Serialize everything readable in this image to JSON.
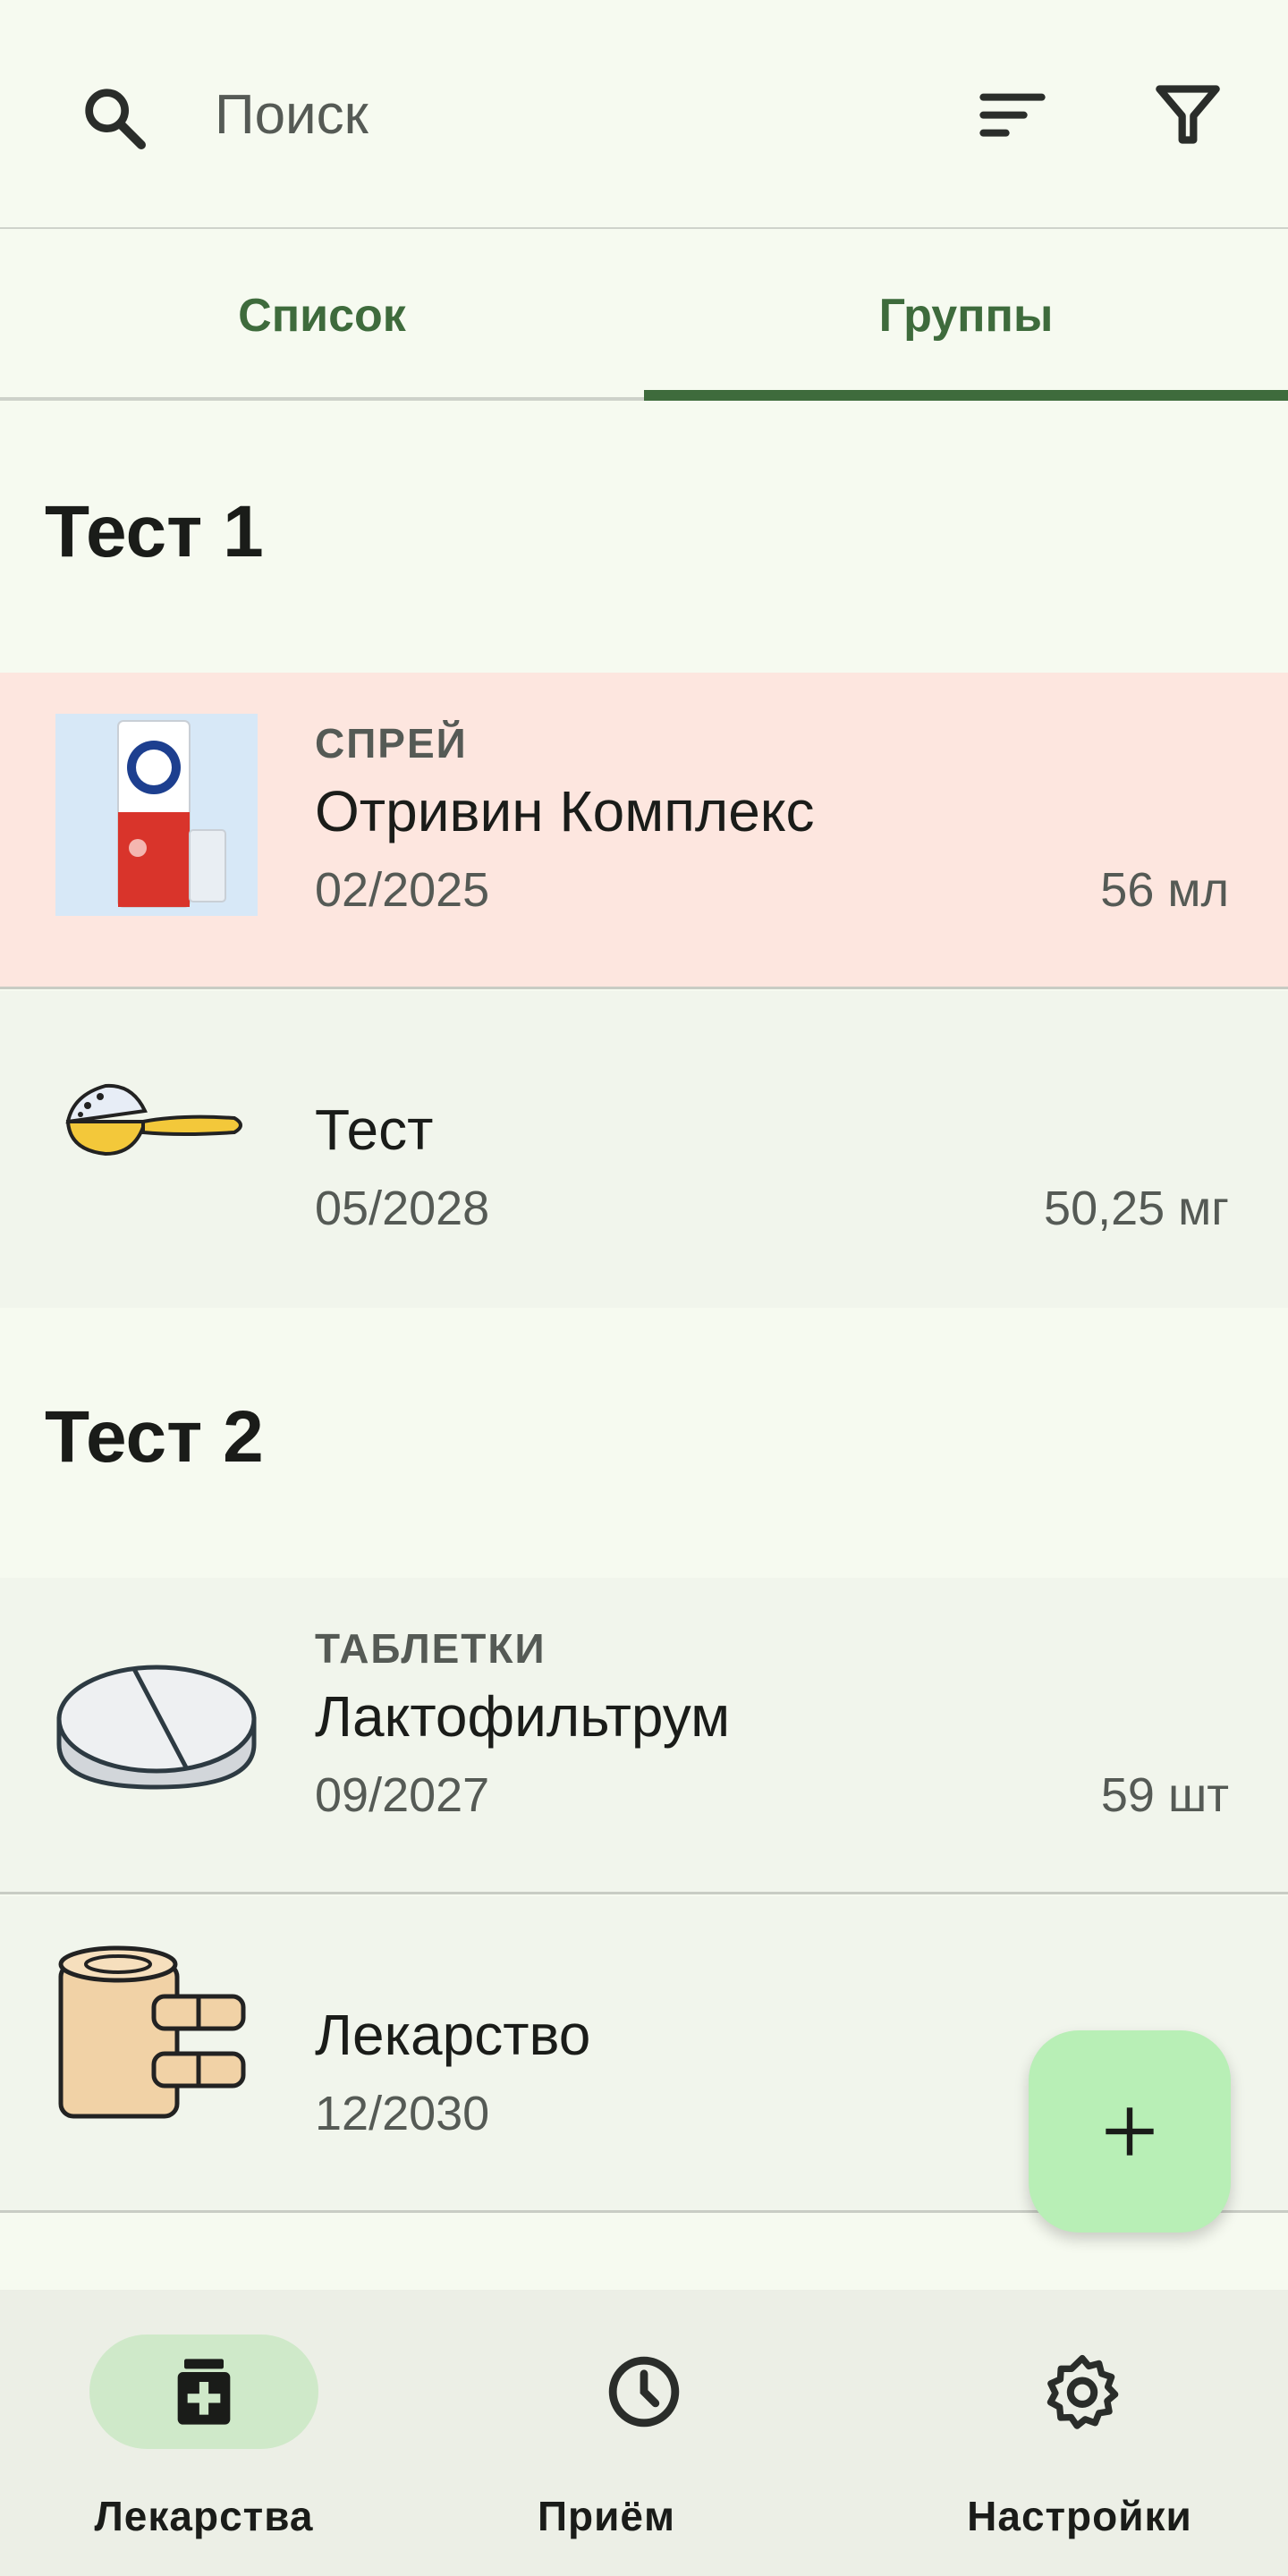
{
  "search": {
    "placeholder": "Поиск"
  },
  "tabs": [
    {
      "label": "Список",
      "selected": false
    },
    {
      "label": "Группы",
      "selected": true
    }
  ],
  "groups": [
    {
      "title": "Тест 1",
      "items": [
        {
          "type": "СПРЕЙ",
          "name": "Отривин Комплекс",
          "date": "02/2025",
          "amount": "56 мл",
          "thumb": "otrivin-spray-photo",
          "highlight": "#fde6df"
        },
        {
          "type": "",
          "name": "Тест",
          "date": "05/2028",
          "amount": "50,25 мг",
          "thumb": "powder-spoon-icon"
        }
      ]
    },
    {
      "title": "Тест 2",
      "items": [
        {
          "type": "ТАБЛЕТКИ",
          "name": "Лактофильтрум",
          "date": "09/2027",
          "amount": "59 шт",
          "thumb": "pill-tablet-icon"
        },
        {
          "type": "",
          "name": "Лекарство",
          "date": "12/2030",
          "amount": "",
          "thumb": "bandage-roll-icon"
        }
      ]
    }
  ],
  "fab": {
    "icon": "plus-icon"
  },
  "bottom_nav": [
    {
      "label": "Лекарства",
      "icon": "medicine-icon",
      "selected": true
    },
    {
      "label": "Приём",
      "icon": "clock-icon",
      "selected": false
    },
    {
      "label": "Настройки",
      "icon": "gear-icon",
      "selected": false
    }
  ],
  "colors": {
    "accent": "#3e6b3c",
    "alert_row": "#fde6df",
    "fab": "#b8efb6",
    "nav_pill": "#cfe9c9"
  }
}
